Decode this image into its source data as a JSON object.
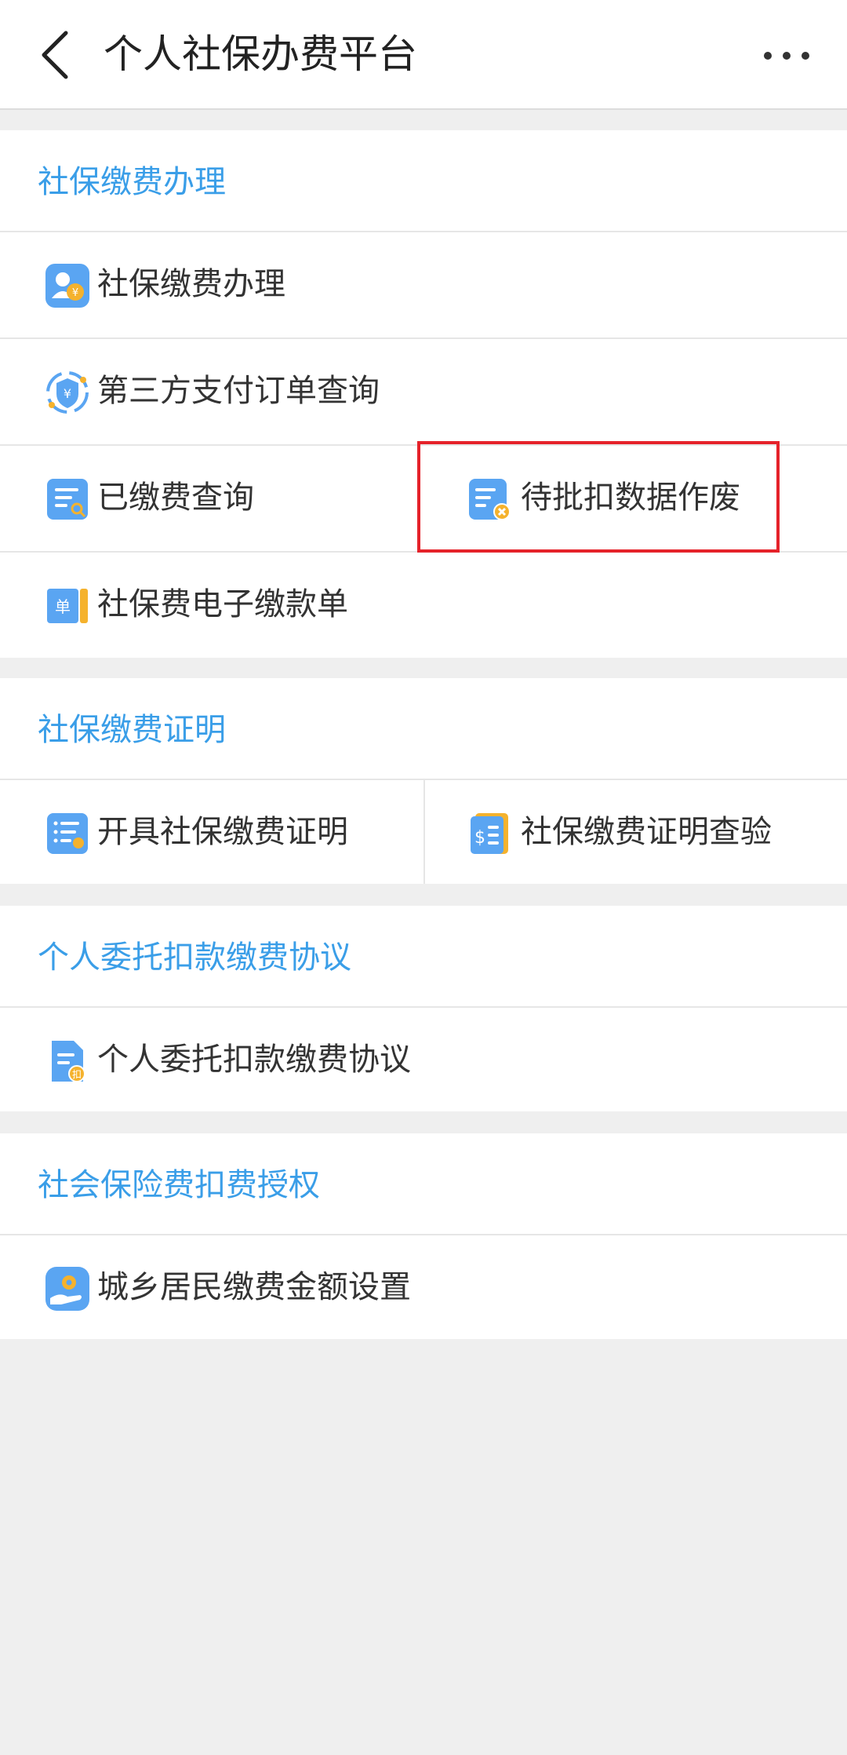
{
  "header": {
    "title": "个人社保办费平台"
  },
  "sections": [
    {
      "title": "社保缴费办理",
      "items": [
        {
          "label": "社保缴费办理",
          "icon": "person-coin-icon"
        },
        {
          "label": "第三方支付订单查询",
          "icon": "shield-yuan-icon"
        },
        {
          "label": "已缴费查询",
          "icon": "document-search-icon"
        },
        {
          "label": "待批扣数据作废",
          "icon": "document-cancel-icon"
        },
        {
          "label": "社保费电子缴款单",
          "icon": "ticket-icon",
          "badge": "单"
        }
      ]
    },
    {
      "title": "社保缴费证明",
      "items": [
        {
          "label": "开具社保缴费证明",
          "icon": "certificate-list-icon"
        },
        {
          "label": "社保缴费证明查验",
          "icon": "bill-verify-icon"
        }
      ]
    },
    {
      "title": "个人委托扣款缴费协议",
      "items": [
        {
          "label": "个人委托扣款缴费协议",
          "icon": "agreement-deduct-icon",
          "badge": "扣"
        }
      ]
    },
    {
      "title": "社会保险费扣费授权",
      "items": [
        {
          "label": "城乡居民缴费金额设置",
          "icon": "hand-gear-icon"
        }
      ]
    }
  ],
  "colors": {
    "accent": "#3a9ee8",
    "highlight": "#e5222a",
    "icon_blue": "#5aa5f2",
    "icon_orange": "#f5b22d"
  }
}
